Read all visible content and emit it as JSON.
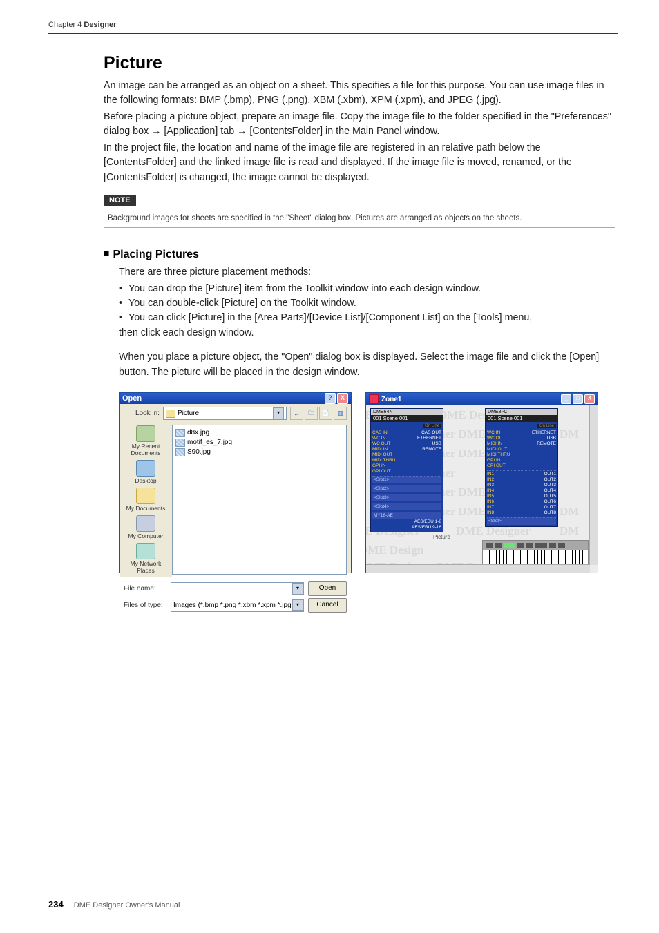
{
  "header": {
    "chapter_label": "Chapter 4 ",
    "chapter_title": "Designer"
  },
  "section": {
    "title": "Picture",
    "para1": "An image can be arranged as an object on a sheet. This specifies a file for this purpose. You can use image files in the following formats: BMP (.bmp), PNG (.png), XBM (.xbm), XPM (.xpm), and JPEG (.jpg).",
    "para2": "Before placing a picture object, prepare an image file. Copy the image file to the folder specified in the \"Preferences\" dialog box → [Application] tab → [ContentsFolder] in the Main Panel window.",
    "para3": "In the project file, the location and name of the image file are registered in an relative path below the [ContentsFolder] and the linked image file is read and displayed. If the image file is moved, renamed, or the [ContentsFolder] is changed, the image cannot be displayed."
  },
  "note": {
    "label": "NOTE",
    "text": "Background images for sheets are specified in the \"Sheet\" dialog box. Pictures are arranged as objects on the sheets."
  },
  "subsection": {
    "heading": "Placing Pictures",
    "intro": "There are three picture placement methods:",
    "bullet1": "You can drop the [Picture] item from the Toolkit window into each design window.",
    "bullet2": "You can double-click [Picture] on the Toolkit window.",
    "bullet3a": "You can click [Picture] in the [Area Parts]/[Device List]/[Component List] on the [Tools] menu,",
    "bullet3b": "then click each design window.",
    "after": "When you place a picture object, the \"Open\" dialog box is displayed. Select the image file and click the [Open] button. The picture will be placed in the design window."
  },
  "open_dialog": {
    "title": "Open",
    "lookin_label": "Look in:",
    "lookin_value": "Picture",
    "nav_icons": [
      "←",
      "🗀",
      "📄",
      "▥"
    ],
    "places": [
      "My Recent Documents",
      "Desktop",
      "My Documents",
      "My Computer",
      "My Network Places"
    ],
    "files": [
      "d8x.jpg",
      "motif_es_7.jpg",
      "S90.jpg"
    ],
    "filename_label": "File name:",
    "filename_value": "",
    "filetype_label": "Files of type:",
    "filetype_value": "Images (*.bmp *.png *.xbm *.xpm *.jpg)",
    "open_btn": "Open",
    "cancel_btn": "Cancel",
    "help_btn": "?",
    "close_btn": "X"
  },
  "zone_window": {
    "title": "Zone1",
    "watermark": "DME Designer",
    "picture_label": "Picture",
    "device1": {
      "header": "DME64N",
      "scene": "001 Scene 001",
      "btn": "On Line",
      "left": [
        "CAS IN",
        "WC IN",
        "WC OUT",
        "MIDI IN",
        "MIDI OUT",
        "MIDI THRU",
        "GPI IN",
        "GPI OUT"
      ],
      "right": [
        "CAS OUT",
        "ETHERNET",
        "USB",
        "REMOTE"
      ],
      "slots": [
        "<Slot1>",
        "<Slot2>",
        "<Slot3>",
        "<Slot4>",
        "MY16-AE"
      ],
      "aes": [
        "AES/EBU 1-8",
        "AES/EBU 9-16"
      ]
    },
    "device2": {
      "header": "DME8i-C",
      "scene": "001 Scene 001",
      "btn": "On Line",
      "left": [
        "WC IN",
        "WC OUT",
        "MIDI IN",
        "MIDI OUT",
        "MIDI THRU",
        "GPI IN",
        "GPI OUT"
      ],
      "right": [
        "ETHERNET",
        "USB",
        "REMOTE"
      ],
      "ins": [
        "IN1",
        "IN2",
        "IN3",
        "IN4",
        "IN5",
        "IN6",
        "IN7",
        "IN8"
      ],
      "outs": [
        "OUT1",
        "OUT2",
        "OUT3",
        "OUT4",
        "OUT5",
        "OUT6",
        "OUT7",
        "OUT8"
      ],
      "slot": "<Slot>"
    }
  },
  "footer": {
    "page": "234",
    "manual": "DME Designer Owner's Manual"
  }
}
